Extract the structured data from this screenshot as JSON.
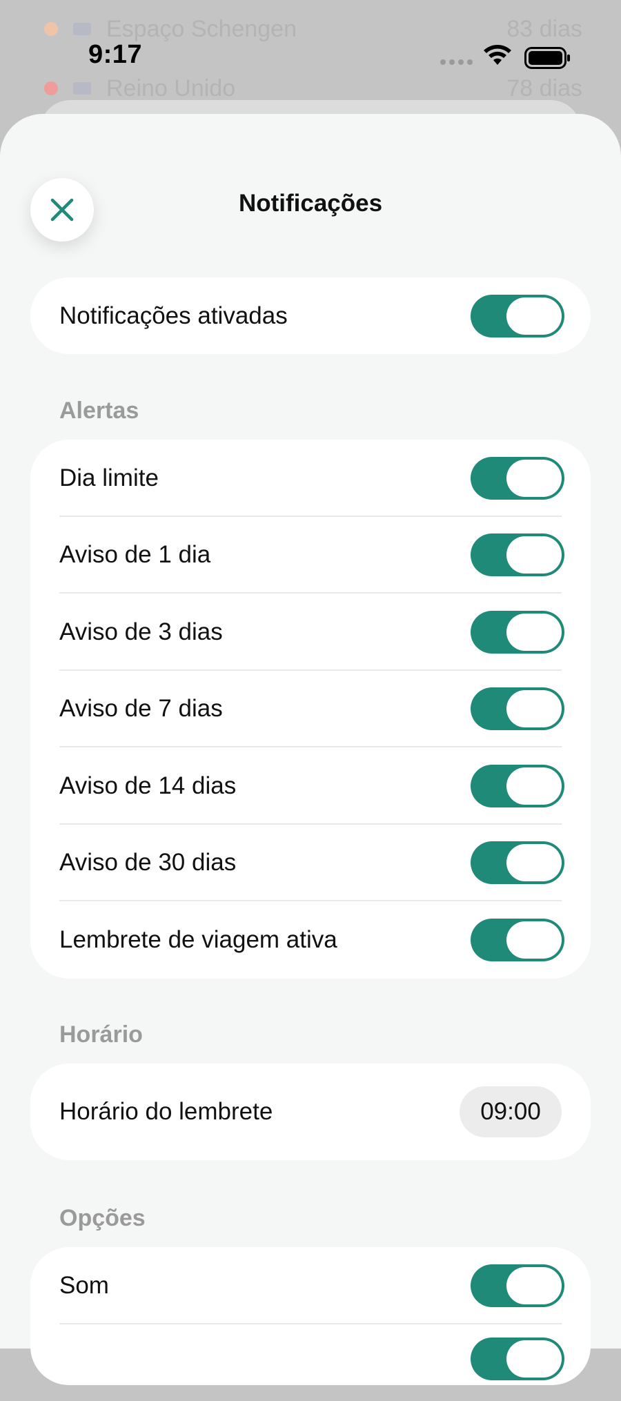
{
  "status_bar": {
    "time": "9:17"
  },
  "background_list": [
    {
      "name": "Espaço Schengen",
      "days": "83 dias",
      "dot_color": "#f0c4a8"
    },
    {
      "name": "Reino Unido",
      "days": "78 dias",
      "dot_color": "#ee9c9c"
    }
  ],
  "sheet": {
    "title": "Notificações",
    "close_icon": "close-icon",
    "master": {
      "label": "Notificações ativadas",
      "on": true
    },
    "alerts_section": {
      "title": "Alertas",
      "items": [
        {
          "label": "Dia limite",
          "on": true
        },
        {
          "label": "Aviso de 1 dia",
          "on": true
        },
        {
          "label": "Aviso de 3 dias",
          "on": true
        },
        {
          "label": "Aviso de 7 dias",
          "on": true
        },
        {
          "label": "Aviso de 14 dias",
          "on": true
        },
        {
          "label": "Aviso de 30 dias",
          "on": true
        },
        {
          "label": "Lembrete de viagem ativa",
          "on": true
        }
      ]
    },
    "time_section": {
      "title": "Horário",
      "label": "Horário do lembrete",
      "value": "09:00"
    },
    "options_section": {
      "title": "Opções",
      "items": [
        {
          "label": "Som",
          "on": true
        },
        {
          "label": "",
          "on": true
        }
      ]
    }
  },
  "colors": {
    "accent": "#1f8a78",
    "sheet_bg": "#f5f6f6",
    "card_bg": "#ffffff",
    "section_label": "#9a9a9a"
  }
}
